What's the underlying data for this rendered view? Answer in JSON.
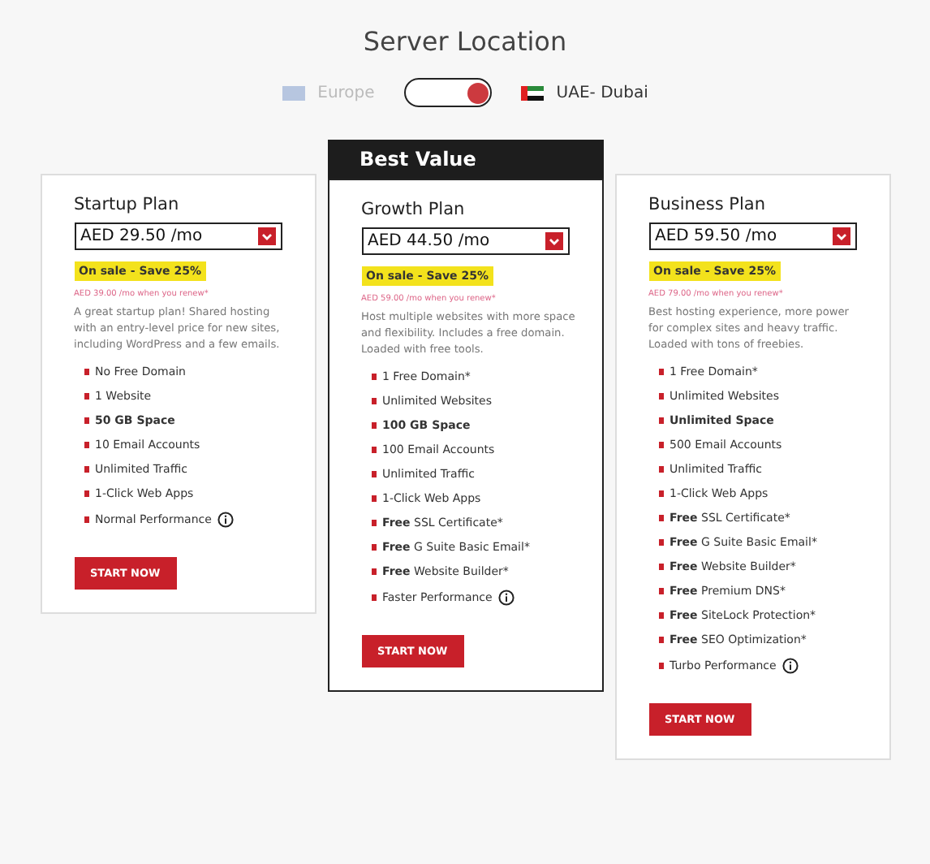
{
  "title": "Server Location",
  "locations": [
    {
      "label": "Europe",
      "selected": false
    },
    {
      "label": "UAE- Dubai",
      "selected": true
    }
  ],
  "plans": [
    {
      "featured": false,
      "name": "Startup Plan",
      "price": "AED 29.50 /mo",
      "sale": "On sale - Save 25%",
      "renew": "AED 39.00 /mo when you renew*",
      "description": "A great startup plan! Shared hosting with an entry-level price for new sites, including WordPress and a few emails.",
      "features": [
        {
          "text": "No Free Domain"
        },
        {
          "text": "1 Website"
        },
        {
          "text": "50 GB Space",
          "bold": true
        },
        {
          "text": "10 Email Accounts"
        },
        {
          "text": "Unlimited Traffic"
        },
        {
          "text": "1-Click Web Apps"
        },
        {
          "text": "Normal Performance",
          "info": true
        }
      ],
      "button": "START NOW"
    },
    {
      "featured": true,
      "badge": "Best Value",
      "name": "Growth Plan",
      "price": "AED 44.50 /mo",
      "sale": "On sale - Save 25%",
      "renew": "AED 59.00 /mo when you renew*",
      "description": "Host multiple websites with more space and flexibility. Includes a free domain. Loaded with free tools.",
      "features": [
        {
          "text": "1 Free Domain*"
        },
        {
          "text": "Unlimited Websites"
        },
        {
          "text": "100 GB Space",
          "bold": true
        },
        {
          "text": "100 Email Accounts"
        },
        {
          "text": "Unlimited Traffic"
        },
        {
          "text": "1-Click Web Apps"
        },
        {
          "strong": "Free",
          "text": "SSL Certificate*"
        },
        {
          "strong": "Free",
          "text": "G Suite Basic Email*"
        },
        {
          "strong": "Free",
          "text": "Website Builder*"
        },
        {
          "text": "Faster Performance",
          "info": true
        }
      ],
      "button": "START NOW"
    },
    {
      "featured": false,
      "name": "Business Plan",
      "price": "AED 59.50 /mo",
      "sale": "On sale - Save 25%",
      "renew": "AED 79.00 /mo when you renew*",
      "description": "Best hosting experience, more power for complex sites and heavy traffic. Loaded with tons of freebies.",
      "features": [
        {
          "text": "1 Free Domain*"
        },
        {
          "text": "Unlimited Websites"
        },
        {
          "text": "Unlimited Space",
          "bold": true
        },
        {
          "text": "500 Email Accounts"
        },
        {
          "text": "Unlimited Traffic"
        },
        {
          "text": "1-Click Web Apps"
        },
        {
          "strong": "Free",
          "text": "SSL Certificate*"
        },
        {
          "strong": "Free",
          "text": "G Suite Basic Email*"
        },
        {
          "strong": "Free",
          "text": "Website Builder*"
        },
        {
          "strong": "Free",
          "text": "Premium DNS*"
        },
        {
          "strong": "Free",
          "text": "SiteLock Protection*"
        },
        {
          "strong": "Free",
          "text": "SEO Optimization*"
        },
        {
          "text": "Turbo Performance",
          "info": true
        }
      ],
      "button": "START NOW"
    }
  ]
}
